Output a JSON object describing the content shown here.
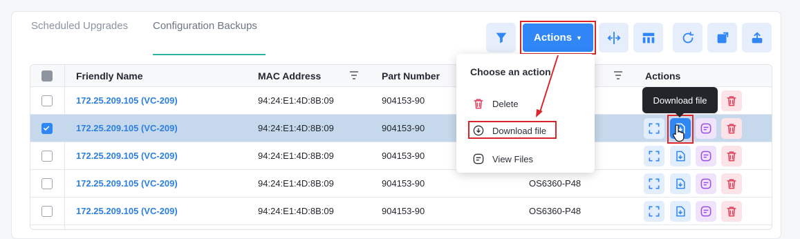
{
  "tabs": [
    {
      "label": "Scheduled Upgrades",
      "active": false
    },
    {
      "label": "Configuration Backups",
      "active": true
    }
  ],
  "toolbar": {
    "actions_label": "Actions",
    "icons": [
      "filter-icon",
      "column-resize-icon",
      "table-layout-icon",
      "refresh-icon",
      "open-external-icon",
      "upload-icon"
    ]
  },
  "table": {
    "headers": {
      "friendly_name": "Friendly Name",
      "mac_address": "MAC Address",
      "part_number": "Part Number",
      "actions": "Actions"
    },
    "rows": [
      {
        "friendly_name": "172.25.209.105 (VC-209)",
        "mac": "94:24:E1:4D:8B:09",
        "part": "904153-90",
        "model": "",
        "selected": false
      },
      {
        "friendly_name": "172.25.209.105 (VC-209)",
        "mac": "94:24:E1:4D:8B:09",
        "part": "904153-90",
        "model": "",
        "selected": true
      },
      {
        "friendly_name": "172.25.209.105 (VC-209)",
        "mac": "94:24:E1:4D:8B:09",
        "part": "904153-90",
        "model": "",
        "selected": false
      },
      {
        "friendly_name": "172.25.209.105 (VC-209)",
        "mac": "94:24:E1:4D:8B:09",
        "part": "904153-90",
        "model": "OS6360-P48",
        "selected": false
      },
      {
        "friendly_name": "172.25.209.105 (VC-209)",
        "mac": "94:24:E1:4D:8B:09",
        "part": "904153-90",
        "model": "OS6360-P48",
        "selected": false
      }
    ]
  },
  "menu": {
    "title": "Choose an action",
    "items": [
      {
        "label": "Delete",
        "icon": "trash-icon"
      },
      {
        "label": "Download file",
        "icon": "download-file-icon"
      },
      {
        "label": "View Files",
        "icon": "view-files-icon"
      }
    ]
  },
  "tooltip": {
    "text": "Download file"
  },
  "colors": {
    "primary": "#2f86f4",
    "highlight": "#d8262a",
    "link": "#2c7fe0",
    "selected_row": "#c6d9ec",
    "tab_underline": "#2bb3a0"
  }
}
